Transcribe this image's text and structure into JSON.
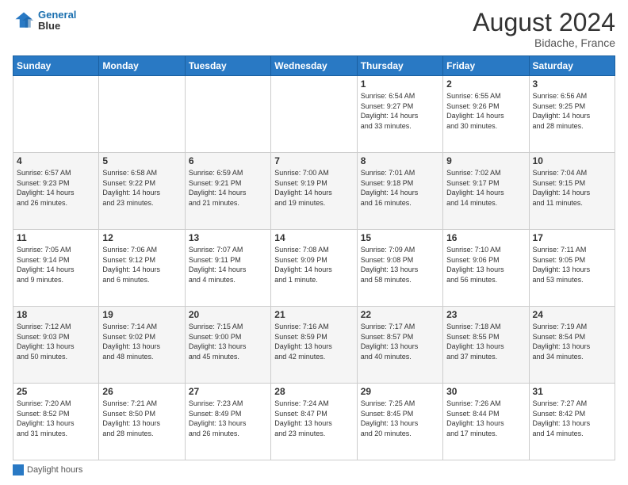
{
  "header": {
    "logo_line1": "General",
    "logo_line2": "Blue",
    "month": "August 2024",
    "location": "Bidache, France"
  },
  "days_of_week": [
    "Sunday",
    "Monday",
    "Tuesday",
    "Wednesday",
    "Thursday",
    "Friday",
    "Saturday"
  ],
  "legend": "Daylight hours",
  "weeks": [
    [
      {
        "day": "",
        "info": ""
      },
      {
        "day": "",
        "info": ""
      },
      {
        "day": "",
        "info": ""
      },
      {
        "day": "",
        "info": ""
      },
      {
        "day": "1",
        "info": "Sunrise: 6:54 AM\nSunset: 9:27 PM\nDaylight: 14 hours\nand 33 minutes."
      },
      {
        "day": "2",
        "info": "Sunrise: 6:55 AM\nSunset: 9:26 PM\nDaylight: 14 hours\nand 30 minutes."
      },
      {
        "day": "3",
        "info": "Sunrise: 6:56 AM\nSunset: 9:25 PM\nDaylight: 14 hours\nand 28 minutes."
      }
    ],
    [
      {
        "day": "4",
        "info": "Sunrise: 6:57 AM\nSunset: 9:23 PM\nDaylight: 14 hours\nand 26 minutes."
      },
      {
        "day": "5",
        "info": "Sunrise: 6:58 AM\nSunset: 9:22 PM\nDaylight: 14 hours\nand 23 minutes."
      },
      {
        "day": "6",
        "info": "Sunrise: 6:59 AM\nSunset: 9:21 PM\nDaylight: 14 hours\nand 21 minutes."
      },
      {
        "day": "7",
        "info": "Sunrise: 7:00 AM\nSunset: 9:19 PM\nDaylight: 14 hours\nand 19 minutes."
      },
      {
        "day": "8",
        "info": "Sunrise: 7:01 AM\nSunset: 9:18 PM\nDaylight: 14 hours\nand 16 minutes."
      },
      {
        "day": "9",
        "info": "Sunrise: 7:02 AM\nSunset: 9:17 PM\nDaylight: 14 hours\nand 14 minutes."
      },
      {
        "day": "10",
        "info": "Sunrise: 7:04 AM\nSunset: 9:15 PM\nDaylight: 14 hours\nand 11 minutes."
      }
    ],
    [
      {
        "day": "11",
        "info": "Sunrise: 7:05 AM\nSunset: 9:14 PM\nDaylight: 14 hours\nand 9 minutes."
      },
      {
        "day": "12",
        "info": "Sunrise: 7:06 AM\nSunset: 9:12 PM\nDaylight: 14 hours\nand 6 minutes."
      },
      {
        "day": "13",
        "info": "Sunrise: 7:07 AM\nSunset: 9:11 PM\nDaylight: 14 hours\nand 4 minutes."
      },
      {
        "day": "14",
        "info": "Sunrise: 7:08 AM\nSunset: 9:09 PM\nDaylight: 14 hours\nand 1 minute."
      },
      {
        "day": "15",
        "info": "Sunrise: 7:09 AM\nSunset: 9:08 PM\nDaylight: 13 hours\nand 58 minutes."
      },
      {
        "day": "16",
        "info": "Sunrise: 7:10 AM\nSunset: 9:06 PM\nDaylight: 13 hours\nand 56 minutes."
      },
      {
        "day": "17",
        "info": "Sunrise: 7:11 AM\nSunset: 9:05 PM\nDaylight: 13 hours\nand 53 minutes."
      }
    ],
    [
      {
        "day": "18",
        "info": "Sunrise: 7:12 AM\nSunset: 9:03 PM\nDaylight: 13 hours\nand 50 minutes."
      },
      {
        "day": "19",
        "info": "Sunrise: 7:14 AM\nSunset: 9:02 PM\nDaylight: 13 hours\nand 48 minutes."
      },
      {
        "day": "20",
        "info": "Sunrise: 7:15 AM\nSunset: 9:00 PM\nDaylight: 13 hours\nand 45 minutes."
      },
      {
        "day": "21",
        "info": "Sunrise: 7:16 AM\nSunset: 8:59 PM\nDaylight: 13 hours\nand 42 minutes."
      },
      {
        "day": "22",
        "info": "Sunrise: 7:17 AM\nSunset: 8:57 PM\nDaylight: 13 hours\nand 40 minutes."
      },
      {
        "day": "23",
        "info": "Sunrise: 7:18 AM\nSunset: 8:55 PM\nDaylight: 13 hours\nand 37 minutes."
      },
      {
        "day": "24",
        "info": "Sunrise: 7:19 AM\nSunset: 8:54 PM\nDaylight: 13 hours\nand 34 minutes."
      }
    ],
    [
      {
        "day": "25",
        "info": "Sunrise: 7:20 AM\nSunset: 8:52 PM\nDaylight: 13 hours\nand 31 minutes."
      },
      {
        "day": "26",
        "info": "Sunrise: 7:21 AM\nSunset: 8:50 PM\nDaylight: 13 hours\nand 28 minutes."
      },
      {
        "day": "27",
        "info": "Sunrise: 7:23 AM\nSunset: 8:49 PM\nDaylight: 13 hours\nand 26 minutes."
      },
      {
        "day": "28",
        "info": "Sunrise: 7:24 AM\nSunset: 8:47 PM\nDaylight: 13 hours\nand 23 minutes."
      },
      {
        "day": "29",
        "info": "Sunrise: 7:25 AM\nSunset: 8:45 PM\nDaylight: 13 hours\nand 20 minutes."
      },
      {
        "day": "30",
        "info": "Sunrise: 7:26 AM\nSunset: 8:44 PM\nDaylight: 13 hours\nand 17 minutes."
      },
      {
        "day": "31",
        "info": "Sunrise: 7:27 AM\nSunset: 8:42 PM\nDaylight: 13 hours\nand 14 minutes."
      }
    ]
  ]
}
